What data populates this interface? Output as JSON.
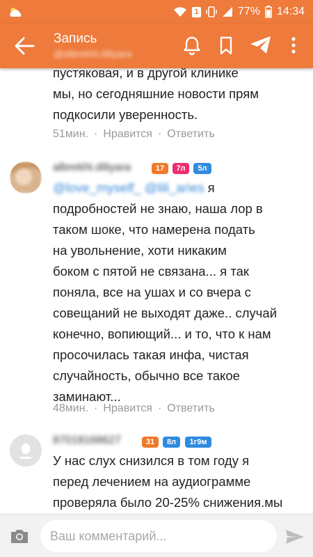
{
  "status_bar": {
    "weather_icon": "partly-cloudy-icon",
    "wifi_icon": "wifi-icon",
    "sim": "1",
    "battery_percent": "77%",
    "time": "14:34"
  },
  "app_bar": {
    "title": "Запись",
    "subtitle": "@albrekht.diliyara",
    "icons": [
      "back-arrow-icon",
      "bell-icon",
      "bookmark-icon",
      "send-icon",
      "more-vert-icon"
    ]
  },
  "feed": {
    "comments": [
      {
        "text_lines": [
          "пустяковая, и в другой клинике",
          "мы, но сегодняшние новости прям",
          "подкосили уверенность."
        ],
        "time": "51мин.",
        "like_label": "Нравится",
        "reply_label": "Ответить"
      },
      {
        "username": "albrekht.diliyara",
        "badges": [
          "17",
          "7л",
          "5л"
        ],
        "mentions": "@love_myself_ @lili_aries",
        "first_line_rest": "я",
        "text_lines": [
          "подробностей не знаю, наша лор в",
          "таком шоке, что намерена подать",
          "на увольнение, хоти никаким",
          "боком с пятой не связана... я так",
          "поняла, все на ушах и со вчера с",
          "совещаний не выходят даже.. случай",
          "конечно, вопиющий... и то, что к нам",
          "просочилась такая инфа, чистая",
          "случайность, обычно все такое",
          "заминают..."
        ],
        "time": "48мин.",
        "like_label": "Нравится",
        "reply_label": "Ответить"
      },
      {
        "username": "87018168627",
        "badges": [
          "31",
          "8л",
          "1г9м"
        ],
        "text_lines": [
          "У нас слух снизился в том году я",
          "перед лечением на аудиограмме",
          "проверяла было 20-25% снижения.мы"
        ]
      }
    ]
  },
  "composer": {
    "placeholder": "Ваш комментарий..."
  },
  "colors": {
    "accent": "#ee7a3b",
    "badge_orange": "#f07a2a",
    "badge_pink": "#ee2e6f",
    "badge_blue": "#2f8be0"
  }
}
